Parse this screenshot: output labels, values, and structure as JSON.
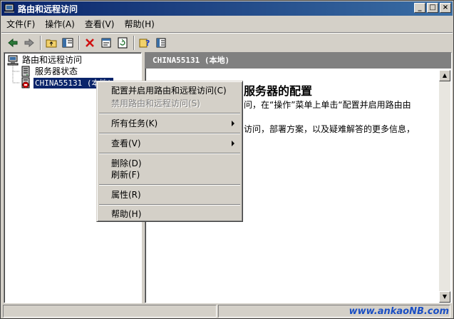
{
  "window": {
    "title": "路由和远程访问",
    "minimize_label": "_",
    "maximize_label": "□",
    "close_label": "×"
  },
  "menubar": {
    "items": [
      {
        "label": "文件(F)"
      },
      {
        "label": "操作(A)"
      },
      {
        "label": "查看(V)"
      },
      {
        "label": "帮助(H)"
      }
    ]
  },
  "toolbar": {
    "icons": [
      "back-arrow-icon",
      "forward-arrow-icon",
      "up-folder-icon",
      "show-hide-tree-icon",
      "delete-icon",
      "properties-icon",
      "refresh-icon",
      "help-icon",
      "export-list-icon"
    ]
  },
  "tree": {
    "root": {
      "label": "路由和远程访问"
    },
    "items": [
      {
        "label": "服务器状态"
      },
      {
        "label": "CHINA55131 (本地)",
        "selected": true
      }
    ]
  },
  "right_pane": {
    "header": "CHINA55131 (本地)",
    "title": "服务器的配置",
    "line1": "问，在“操作”菜单上单击“配置并启用路由由",
    "line2": "访问，部署方案，以及疑难解答的更多信息，"
  },
  "context_menu": {
    "items": [
      {
        "label": "配置并启用路由和远程访问(C)",
        "disabled": false,
        "submenu": false
      },
      {
        "label": "禁用路由和远程访问(S)",
        "disabled": true,
        "submenu": false
      },
      {
        "label": "所有任务(K)",
        "disabled": false,
        "submenu": true
      },
      {
        "label": "查看(V)",
        "disabled": false,
        "submenu": true
      },
      {
        "label": "删除(D)",
        "disabled": false,
        "submenu": false
      },
      {
        "label": "刷新(F)",
        "disabled": false,
        "submenu": false
      },
      {
        "label": "属性(R)",
        "disabled": false,
        "submenu": false
      },
      {
        "label": "帮助(H)",
        "disabled": false,
        "submenu": false
      }
    ]
  },
  "watermark": "www.ankaoNB.com",
  "colors": {
    "titlebar_start": "#0a246a",
    "titlebar_end": "#3a6ea5",
    "face": "#d4d0c8",
    "selection": "#0a246a"
  }
}
